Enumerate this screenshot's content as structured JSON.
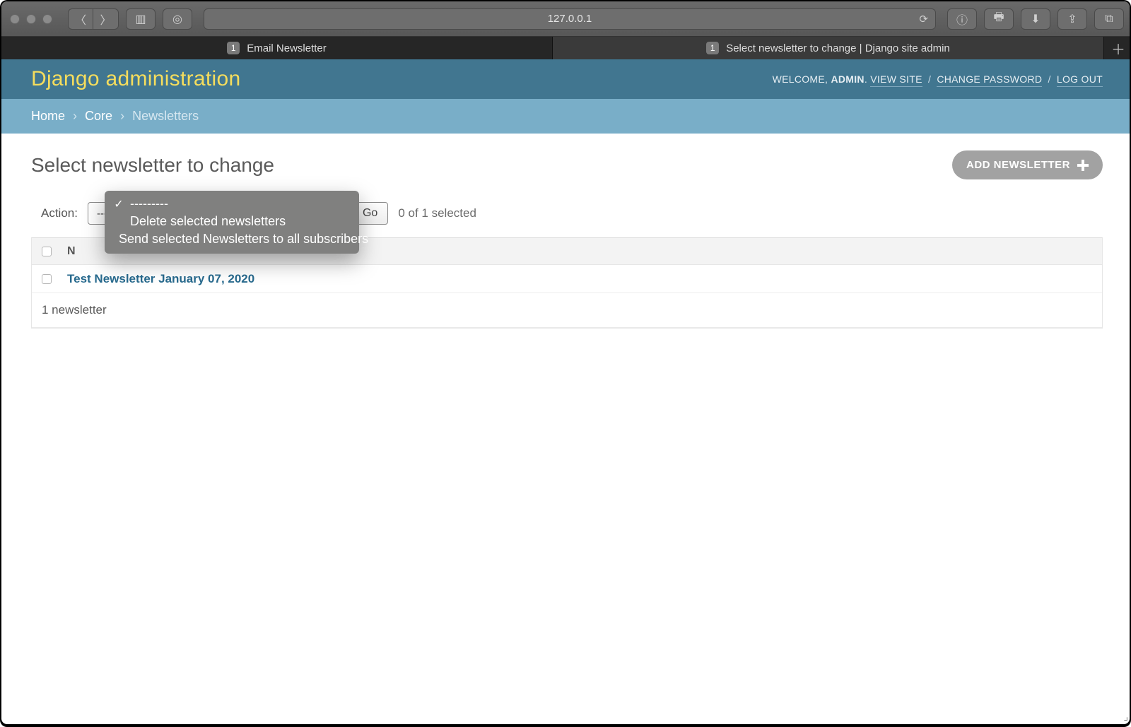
{
  "browser": {
    "url": "127.0.0.1",
    "tabs": [
      {
        "badge": "1",
        "title": "Email Newsletter",
        "active": false
      },
      {
        "badge": "1",
        "title": "Select newsletter to change | Django site admin",
        "active": true
      }
    ]
  },
  "header": {
    "site_title": "Django administration",
    "welcome_label": "WELCOME,",
    "user_name": "ADMIN",
    "links": {
      "view_site": "VIEW SITE",
      "change_password": "CHANGE PASSWORD",
      "log_out": "LOG OUT"
    }
  },
  "breadcrumbs": {
    "home": "Home",
    "app": "Core",
    "current": "Newsletters",
    "sep": "›"
  },
  "page": {
    "title": "Select newsletter to change",
    "add_button": "ADD NEWSLETTER"
  },
  "actions": {
    "label": "Action:",
    "options": [
      "---------",
      "Delete selected newsletters",
      "Send selected Newsletters to all subscribers"
    ],
    "selected_option_index": 0,
    "go_label": "Go",
    "selection_count": "0 of 1 selected"
  },
  "table": {
    "columns": [
      "N"
    ],
    "rows": [
      {
        "name": "Test Newsletter January 07, 2020"
      }
    ],
    "paginator": "1 newsletter"
  }
}
